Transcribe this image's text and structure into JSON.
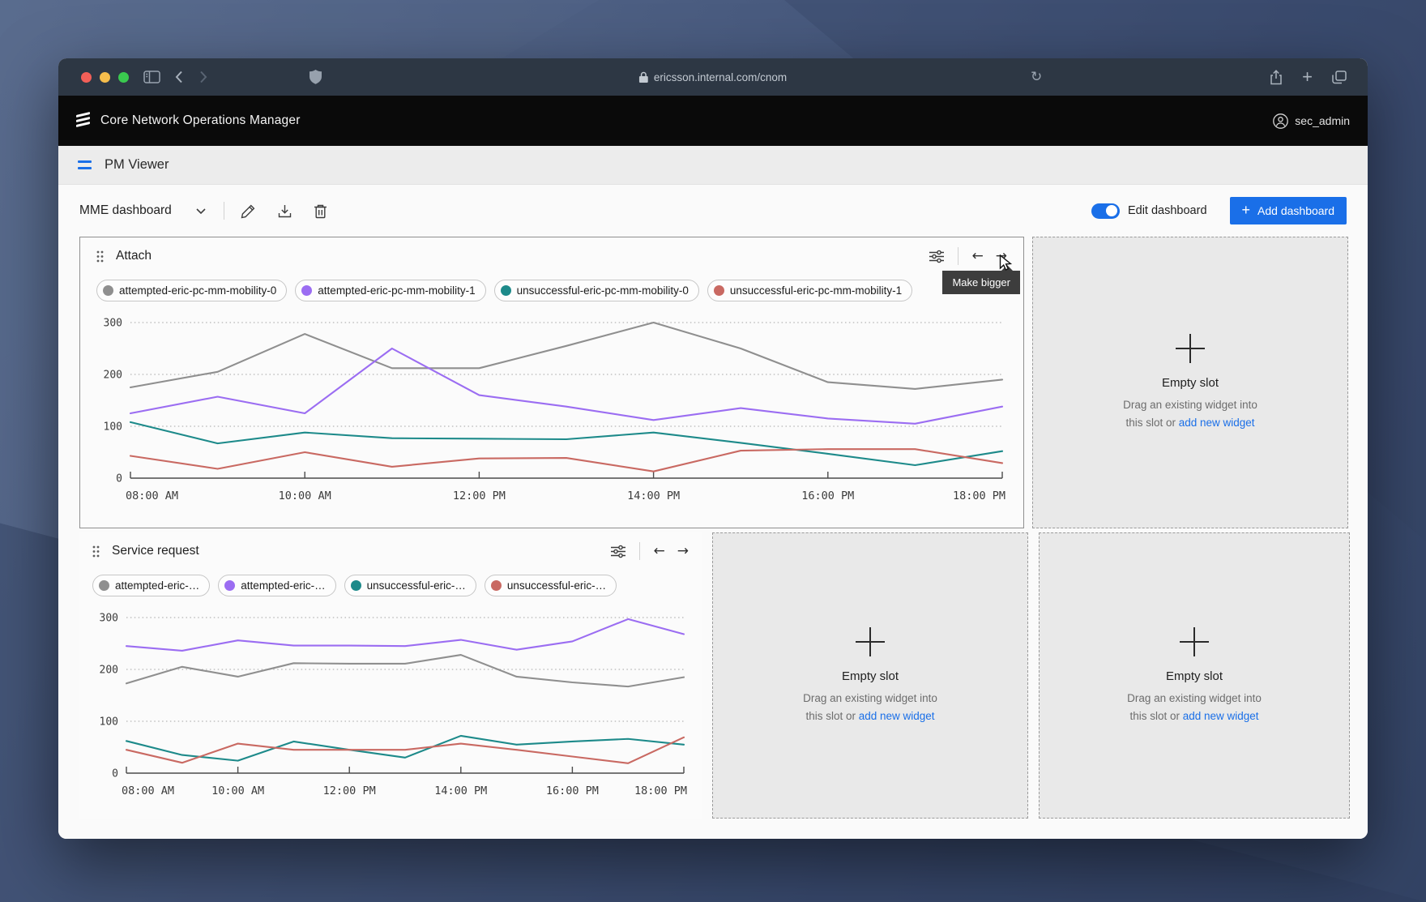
{
  "browser": {
    "url": "ericsson.internal.com/cnom",
    "traffic_lights": {
      "close": "#f25f58",
      "minimize": "#f5bd4c",
      "zoom": "#3ac94f"
    }
  },
  "app_header": {
    "title": "Core Network Operations Manager",
    "username": "sec_admin"
  },
  "page_header": {
    "title": "PM Viewer"
  },
  "toolbar": {
    "dashboard_select": "MME dashboard",
    "edit_toggle_label": "Edit dashboard",
    "add_dashboard_label": "Add dashboard"
  },
  "icons": {
    "plus": "+",
    "arrow_left": "←",
    "arrow_right": "→",
    "reload": "↻"
  },
  "widgets": {
    "attach": {
      "title": "Attach",
      "tooltip": "Make bigger",
      "chips": [
        {
          "label": "attempted-eric-pc-mm-mobility-0",
          "color": "#8f8f8f"
        },
        {
          "label": "attempted-eric-pc-mm-mobility-1",
          "color": "#9b6df2"
        },
        {
          "label": "unsuccessful-eric-pc-mm-mobility-0",
          "color": "#1d8a8a"
        },
        {
          "label": "unsuccessful-eric-pc-mm-mobility-1",
          "color": "#c96962"
        }
      ]
    },
    "service": {
      "title": "Service request",
      "chips": [
        {
          "label": "attempted-eric-…",
          "color": "#8f8f8f"
        },
        {
          "label": "attempted-eric-…",
          "color": "#9b6df2"
        },
        {
          "label": "unsuccessful-eric-…",
          "color": "#1d8a8a"
        },
        {
          "label": "unsuccessful-eric-…",
          "color": "#c96962"
        }
      ]
    }
  },
  "empty_slot": {
    "title": "Empty slot",
    "line1": "Drag an existing widget into",
    "line2": "this slot or",
    "link_label": "add new widget"
  },
  "accent": {
    "blue": "#1a6fe8"
  },
  "chart_data": [
    {
      "type": "line",
      "title": "Attach",
      "x_tick_labels": [
        "08:00 AM",
        "10:00 AM",
        "12:00 PM",
        "14:00 PM",
        "16:00 PM",
        "18:00 PM"
      ],
      "yticks": [
        0,
        100,
        200,
        300
      ],
      "ylim": [
        0,
        300
      ],
      "grid": "dotted-horizontal",
      "legend_position": "top-chips",
      "series": [
        {
          "name": "attempted-eric-pc-mm-mobility-0",
          "color": "#8f8f8f",
          "values": [
            175,
            205,
            278,
            212,
            212,
            255,
            300,
            250,
            185,
            172,
            190
          ]
        },
        {
          "name": "attempted-eric-pc-mm-mobility-1",
          "color": "#9b6df2",
          "values": [
            125,
            157,
            125,
            250,
            160,
            138,
            112,
            135,
            115,
            105,
            138
          ]
        },
        {
          "name": "unsuccessful-eric-pc-mm-mobility-0",
          "color": "#1d8a8a",
          "values": [
            108,
            67,
            88,
            77,
            76,
            75,
            88,
            68,
            47,
            25,
            52
          ]
        },
        {
          "name": "unsuccessful-eric-pc-mm-mobility-1",
          "color": "#c96962",
          "values": [
            43,
            18,
            50,
            22,
            38,
            39,
            13,
            53,
            56,
            56,
            29
          ]
        }
      ]
    },
    {
      "type": "line",
      "title": "Service request",
      "x_tick_labels": [
        "08:00 AM",
        "10:00 AM",
        "12:00 PM",
        "14:00 PM",
        "16:00 PM",
        "18:00 PM"
      ],
      "yticks": [
        0,
        100,
        200,
        300
      ],
      "ylim": [
        0,
        300
      ],
      "grid": "dotted-horizontal",
      "legend_position": "top-chips",
      "series": [
        {
          "name": "attempted-eric-…",
          "color": "#8f8f8f",
          "values": [
            173,
            205,
            186,
            212,
            211,
            211,
            228,
            186,
            175,
            167,
            185
          ]
        },
        {
          "name": "attempted-eric-…",
          "color": "#9b6df2",
          "values": [
            245,
            236,
            256,
            246,
            246,
            245,
            257,
            238,
            254,
            297,
            268
          ]
        },
        {
          "name": "unsuccessful-eric-…",
          "color": "#1d8a8a",
          "values": [
            62,
            35,
            24,
            61,
            45,
            30,
            72,
            55,
            61,
            66,
            55
          ]
        },
        {
          "name": "unsuccessful-eric-…",
          "color": "#c96962",
          "values": [
            45,
            20,
            57,
            45,
            45,
            45,
            57,
            45,
            32,
            19,
            69
          ]
        }
      ]
    }
  ]
}
